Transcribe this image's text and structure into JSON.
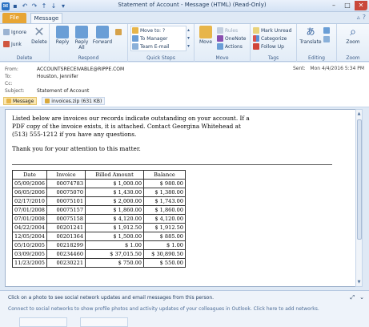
{
  "window": {
    "title": "Statement of Account - Message (HTML) (Read-Only)"
  },
  "tabs": {
    "file": "File",
    "message": "Message"
  },
  "ribbon": {
    "delete_group": {
      "ignore": "Ignore",
      "junk": "Junk",
      "delete": "Delete",
      "label": "Delete"
    },
    "respond_group": {
      "reply": "Reply",
      "reply_all": "Reply All",
      "forward": "Forward",
      "label": "Respond"
    },
    "quick_steps": {
      "move_to": "Move to: ?",
      "to_manager": "To Manager",
      "team_email": "Team E-mail",
      "label": "Quick Steps"
    },
    "move_group": {
      "move": "Move",
      "rules": "Rules",
      "onenote": "OneNote",
      "actions": "Actions",
      "label": "Move"
    },
    "tags_group": {
      "mark_unread": "Mark Unread",
      "categorize": "Categorize",
      "follow_up": "Follow Up",
      "label": "Tags"
    },
    "editing_group": {
      "translate": "Translate",
      "label": "Editing"
    },
    "zoom_group": {
      "zoom": "Zoom",
      "label": "Zoom"
    }
  },
  "header": {
    "from_label": "From:",
    "from_value": "ACCOUNTSRECEIVABLE@RIPPE.COM",
    "to_label": "To:",
    "to_value": "Houston, Jennifer",
    "cc_label": "Cc:",
    "cc_value": "",
    "subject_label": "Subject:",
    "subject_value": "Statement of Account",
    "sent_label": "Sent:",
    "sent_value": "Mon 4/4/2016 5:34 PM",
    "attachments": [
      {
        "name": "Message"
      },
      {
        "name": "invoices.zip (631 KB)"
      }
    ]
  },
  "body": {
    "paragraph1": "Listed below are invoices our records indicate outstanding on your account. If a PDF copy of the invoice exists, it is attached. Contact Georgina Whitehead at (513) 555-1212 if you have any questions.",
    "paragraph2": "Thank you for your attention to this matter.",
    "table": {
      "headers": [
        "Date",
        "Invoice",
        "Billed Amount",
        "Balance"
      ],
      "rows": [
        [
          "05/09/2006",
          "00074783",
          "$ 1,000.00",
          "$ 980.00"
        ],
        [
          "06/05/2006",
          "00075070",
          "$ 1,430.00",
          "$ 1,380.00"
        ],
        [
          "02/17/2010",
          "00075101",
          "$ 2,000.00",
          "$ 1,743.00"
        ],
        [
          "07/01/2008",
          "00075157",
          "$ 1,860.00",
          "$ 1,860.00"
        ],
        [
          "07/01/2008",
          "00075158",
          "$ 4,120.00",
          "$ 4,120.00"
        ],
        [
          "04/22/2004",
          "00201241",
          "$ 1,912.50",
          "$ 1,912.50"
        ],
        [
          "12/05/2004",
          "00201364",
          "$ 1,500.00",
          "$ 885.00"
        ],
        [
          "05/10/2005",
          "00218299",
          "$ 1.00",
          "$ 1.00"
        ],
        [
          "03/09/2005",
          "00234460",
          "$ 37,015.50",
          "$ 30,890.50"
        ],
        [
          "11/23/2005",
          "00230221",
          "$ 750.00",
          "$ 550.00"
        ]
      ]
    }
  },
  "people_pane": {
    "line1": "Click on a photo to see social network updates and email messages from this person.",
    "line2": "Connect to social networks to show profile photos and activity updates of your colleagues in Outlook. Click here to add networks."
  },
  "colors": {
    "file_tab": "#e7a534",
    "ribbon_bg": "#e2ecf7",
    "close_button": "#c9483b"
  }
}
